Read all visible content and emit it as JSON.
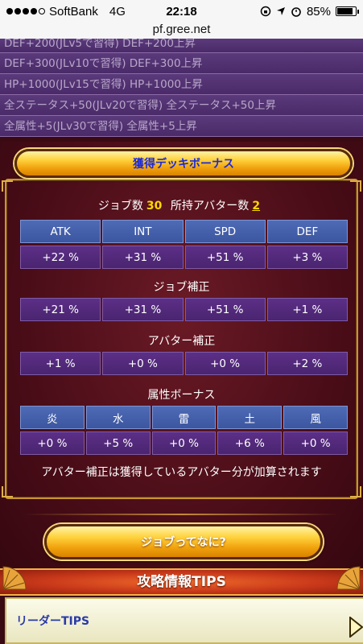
{
  "status_bar": {
    "carrier": "SoftBank",
    "network": "4G",
    "time": "22:18",
    "battery": "85%",
    "battery_level": 0.85
  },
  "url": "pf.gree.net",
  "skill_list": [
    "DEF+200(JLv5で習得) DEF+200上昇",
    "DEF+300(JLv10で習得) DEF+300上昇",
    "HP+1000(JLv15で習得) HP+1000上昇",
    "全ステータス+50(JLv20で習得) 全ステータス+50上昇",
    "全属性+5(JLv30で習得) 全属性+5上昇"
  ],
  "deck_bonus_button": "獲得デッキボーナス",
  "summary": {
    "job_count_label": "ジョブ数",
    "job_count": "30",
    "avatar_count_label": "所持アバター数",
    "avatar_count": "2"
  },
  "stats": {
    "headers": [
      "ATK",
      "INT",
      "SPD",
      "DEF"
    ],
    "values": [
      "+22 %",
      "+31 %",
      "+51 %",
      "+3 %"
    ]
  },
  "job_correction": {
    "label": "ジョブ補正",
    "values": [
      "+21 %",
      "+31 %",
      "+51 %",
      "+1 %"
    ]
  },
  "avatar_correction": {
    "label": "アバター補正",
    "values": [
      "+1 %",
      "+0 %",
      "+0 %",
      "+2 %"
    ]
  },
  "attribute_bonus": {
    "label": "属性ボーナス",
    "headers": [
      "炎",
      "水",
      "雷",
      "土",
      "風"
    ],
    "values": [
      "+0 %",
      "+5 %",
      "+0 %",
      "+6 %",
      "+0 %"
    ]
  },
  "note": "アバター補正は獲得しているアバター分が加算されます",
  "job_info_button": "ジョブってなに?",
  "tips_header": "攻略情報TIPS",
  "tips_item": "リーダーTIPS",
  "colors": {
    "panel_bg": "#4a0d18",
    "gold": "#ffd700",
    "header_blue": "#4f6bb5",
    "value_purple": "#5c2f86",
    "link_blue": "#2a3aa8"
  }
}
